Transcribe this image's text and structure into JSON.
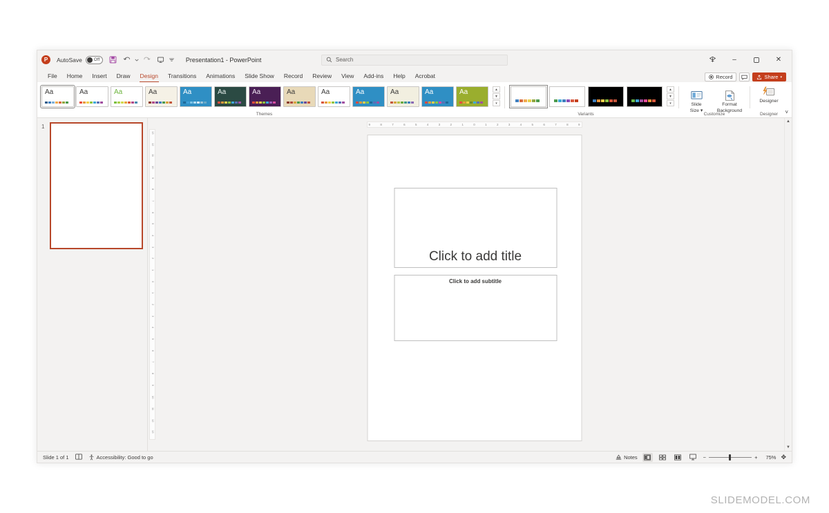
{
  "app": {
    "logo_letter": "P",
    "autosave_label": "AutoSave",
    "autosave_state": "Off",
    "document_title": "Presentation1",
    "document_suffix": "- PowerPoint",
    "full_title": "Presentation1  -  PowerPoint"
  },
  "search": {
    "placeholder": "Search"
  },
  "window_controls": {
    "minimize": "–",
    "maximize": "☐",
    "close": "✕"
  },
  "quick_access": [
    {
      "name": "save-icon",
      "glyph": "💾"
    },
    {
      "name": "undo-icon",
      "glyph": "↶"
    },
    {
      "name": "redo-icon",
      "glyph": "↷"
    },
    {
      "name": "start-presentation-icon",
      "glyph": "⬜"
    },
    {
      "name": "customize-qat-icon",
      "glyph": "≡"
    }
  ],
  "tabs": [
    {
      "label": "File",
      "active": false
    },
    {
      "label": "Home",
      "active": false
    },
    {
      "label": "Insert",
      "active": false
    },
    {
      "label": "Draw",
      "active": false
    },
    {
      "label": "Design",
      "active": true
    },
    {
      "label": "Transitions",
      "active": false
    },
    {
      "label": "Animations",
      "active": false
    },
    {
      "label": "Slide Show",
      "active": false
    },
    {
      "label": "Record",
      "active": false
    },
    {
      "label": "Review",
      "active": false
    },
    {
      "label": "View",
      "active": false
    },
    {
      "label": "Add-ins",
      "active": false
    },
    {
      "label": "Help",
      "active": false
    },
    {
      "label": "Acrobat",
      "active": false
    }
  ],
  "tab_actions": {
    "record_label": "Record",
    "comments_label": "Comments",
    "share_label": "Share",
    "share_caret": "▾"
  },
  "ribbon": {
    "themes": {
      "group_label": "Themes",
      "items": [
        {
          "name": "theme-office",
          "aa": "Aa",
          "bg": "#ffffff",
          "fg": "#3b3a39",
          "colors": [
            "#2e5c8a",
            "#3f7fbf",
            "#7cb0d8",
            "#f0ab4e",
            "#d8693c",
            "#8fa63f",
            "#4c9a4c"
          ]
        },
        {
          "name": "theme-berlin",
          "aa": "Aa",
          "bg": "#ffffff",
          "fg": "#3b3a39",
          "colors": [
            "#e84c3d",
            "#e89a3c",
            "#f2d04b",
            "#8fc440",
            "#3fa9d8",
            "#5a6fb5",
            "#a14fa1"
          ]
        },
        {
          "name": "theme-celestial",
          "aa": "Aa",
          "bg": "#ffffff",
          "fg": "#6eb43f",
          "colors": [
            "#7cbf3f",
            "#a8cf4a",
            "#d2d84b",
            "#e8a63c",
            "#d8563c",
            "#b04a8a",
            "#4a8ab0"
          ]
        },
        {
          "name": "theme-wood-type",
          "aa": "Aa",
          "bg": "#f5f1e6",
          "fg": "#3b3a39",
          "colors": [
            "#8a3c2e",
            "#b04a8a",
            "#6a4a9a",
            "#3f7fbf",
            "#4c9a4c",
            "#d8a33c",
            "#c4563c"
          ]
        },
        {
          "name": "theme-droplet",
          "aa": "Aa",
          "bg": "#2f8fc4",
          "fg": "#ffffff",
          "colors": [
            "#1f6a9a",
            "#3f9fd8",
            "#7cc4e8",
            "#b0dcf2",
            "#d8eaf5",
            "#9ac4d8",
            "#6aa8c4"
          ]
        },
        {
          "name": "theme-slice-dark",
          "aa": "Aa",
          "bg": "#2b4a43",
          "fg": "#eaf2ef",
          "colors": [
            "#e84c3d",
            "#e89a3c",
            "#f2d04b",
            "#8fc440",
            "#3fa9d8",
            "#5a6fb5",
            "#a14fa1"
          ]
        },
        {
          "name": "theme-quotable",
          "aa": "Aa",
          "bg": "#4a1f55",
          "fg": "#f2e8f5",
          "colors": [
            "#e84c3d",
            "#f2a03c",
            "#f2d04b",
            "#8fc440",
            "#3fa9d8",
            "#9a5ab5",
            "#d84ca1"
          ]
        },
        {
          "name": "theme-parcel",
          "aa": "Aa",
          "bg": "#e8d9b8",
          "fg": "#3b3a39",
          "colors": [
            "#8a3c2e",
            "#b04a3c",
            "#d8a33c",
            "#4c9a4c",
            "#3f7fbf",
            "#6a4a9a",
            "#c4563c"
          ]
        },
        {
          "name": "theme-basis",
          "aa": "Aa",
          "bg": "#ffffff",
          "fg": "#3b3a39",
          "colors": [
            "#d8563c",
            "#e89a3c",
            "#f2d04b",
            "#8fc440",
            "#3fa9d8",
            "#5a6fb5",
            "#a14fa1"
          ]
        },
        {
          "name": "theme-ion-boardroom",
          "aa": "Aa",
          "bg": "#2f8fc4",
          "fg": "#ffffff",
          "colors": [
            "#e84c3d",
            "#e89a3c",
            "#f2d04b",
            "#8fc440",
            "#1f6a9a",
            "#5a6fb5",
            "#a14fa1"
          ]
        },
        {
          "name": "theme-dividend",
          "aa": "Aa",
          "bg": "#f2efe0",
          "fg": "#3b3a39",
          "colors": [
            "#c4563c",
            "#d8a33c",
            "#b5c44a",
            "#6aa83f",
            "#3f9a8a",
            "#3f7fbf",
            "#8a6ab5"
          ]
        },
        {
          "name": "theme-banded",
          "aa": "Aa",
          "bg": "#2f8fc4",
          "fg": "#ffffff",
          "colors": [
            "#e84c3d",
            "#f2a03c",
            "#f2d04b",
            "#8fc440",
            "#d84ca1",
            "#5a6fb5",
            "#1f6a9a"
          ]
        },
        {
          "name": "theme-savon",
          "aa": "Aa",
          "bg": "#9aae2e",
          "fg": "#ffffff",
          "colors": [
            "#e84c3d",
            "#e89a3c",
            "#f2d04b",
            "#6a8a2e",
            "#3fa9d8",
            "#5a6fb5",
            "#a14fa1"
          ]
        }
      ],
      "scroll_up": "▲",
      "scroll_down": "▼",
      "more": "▾"
    },
    "variants": {
      "group_label": "Variants",
      "items": [
        {
          "name": "variant-1",
          "bg": "#ffffff",
          "colors": [
            "#3f7fbf",
            "#d8693c",
            "#f0ab4e",
            "#e8d04b",
            "#8fa63f",
            "#4c9a4c"
          ]
        },
        {
          "name": "variant-2",
          "bg": "#ffffff",
          "colors": [
            "#4c9a4c",
            "#3fa9d8",
            "#3f7fbf",
            "#8a4ab5",
            "#d8563c",
            "#c43e1c"
          ]
        },
        {
          "name": "variant-3",
          "bg": "#000000",
          "colors": [
            "#3f7fbf",
            "#e8953c",
            "#f2d04b",
            "#8fc440",
            "#d8563c",
            "#c4563c"
          ]
        },
        {
          "name": "variant-4",
          "bg": "#000000",
          "colors": [
            "#6aba4a",
            "#3fa9d8",
            "#a14fa1",
            "#e84c9a",
            "#e8953c",
            "#d8563c"
          ]
        }
      ],
      "scroll_up": "▲",
      "scroll_down": "▼",
      "more": "▾"
    },
    "customize": {
      "group_label": "Customize",
      "slide_size_label_1": "Slide",
      "slide_size_label_2": "Size ▾",
      "format_background_label_1": "Format",
      "format_background_label_2": "Background"
    },
    "designer": {
      "group_label": "Designer",
      "button_label": "Designer"
    },
    "collapse_ribbon": "˅"
  },
  "slide_pane": {
    "slide_number": "1"
  },
  "rulers": {
    "horizontal": [
      "9",
      "8",
      "7",
      "6",
      "5",
      "4",
      "3",
      "2",
      "1",
      "0",
      "1",
      "2",
      "3",
      "4",
      "5",
      "6",
      "7",
      "8",
      "9"
    ],
    "vertical": [
      "13",
      "12",
      "11",
      "10",
      "9",
      "8",
      "7",
      "6",
      "5",
      "4",
      "3",
      "2",
      "1",
      "0",
      "1",
      "2",
      "3",
      "4",
      "5",
      "6",
      "7",
      "8",
      "9",
      "10",
      "11",
      "12",
      "13"
    ]
  },
  "slide": {
    "title_placeholder": "Click to add title",
    "subtitle_placeholder": "Click to add subtitle"
  },
  "status_bar": {
    "slide_count": "Slide 1 of 1",
    "language_icon": "notes-page-icon",
    "accessibility": "Accessibility: Good to go",
    "notes_label": "Notes",
    "views": [
      {
        "name": "view-normal",
        "active": true
      },
      {
        "name": "view-slide-sorter",
        "active": false
      },
      {
        "name": "view-reading",
        "active": false
      },
      {
        "name": "view-slide-show",
        "active": false
      }
    ],
    "zoom_out": "−",
    "zoom_in": "+",
    "zoom_level": "75%",
    "fit_to_window": "✥"
  },
  "watermark": "SLIDEMODEL.COM",
  "colors": {
    "accent": "#c43e1c",
    "tab_active": "#b7472a",
    "chrome": "#f3f2f1",
    "ribbon_bg": "#ffffff"
  }
}
